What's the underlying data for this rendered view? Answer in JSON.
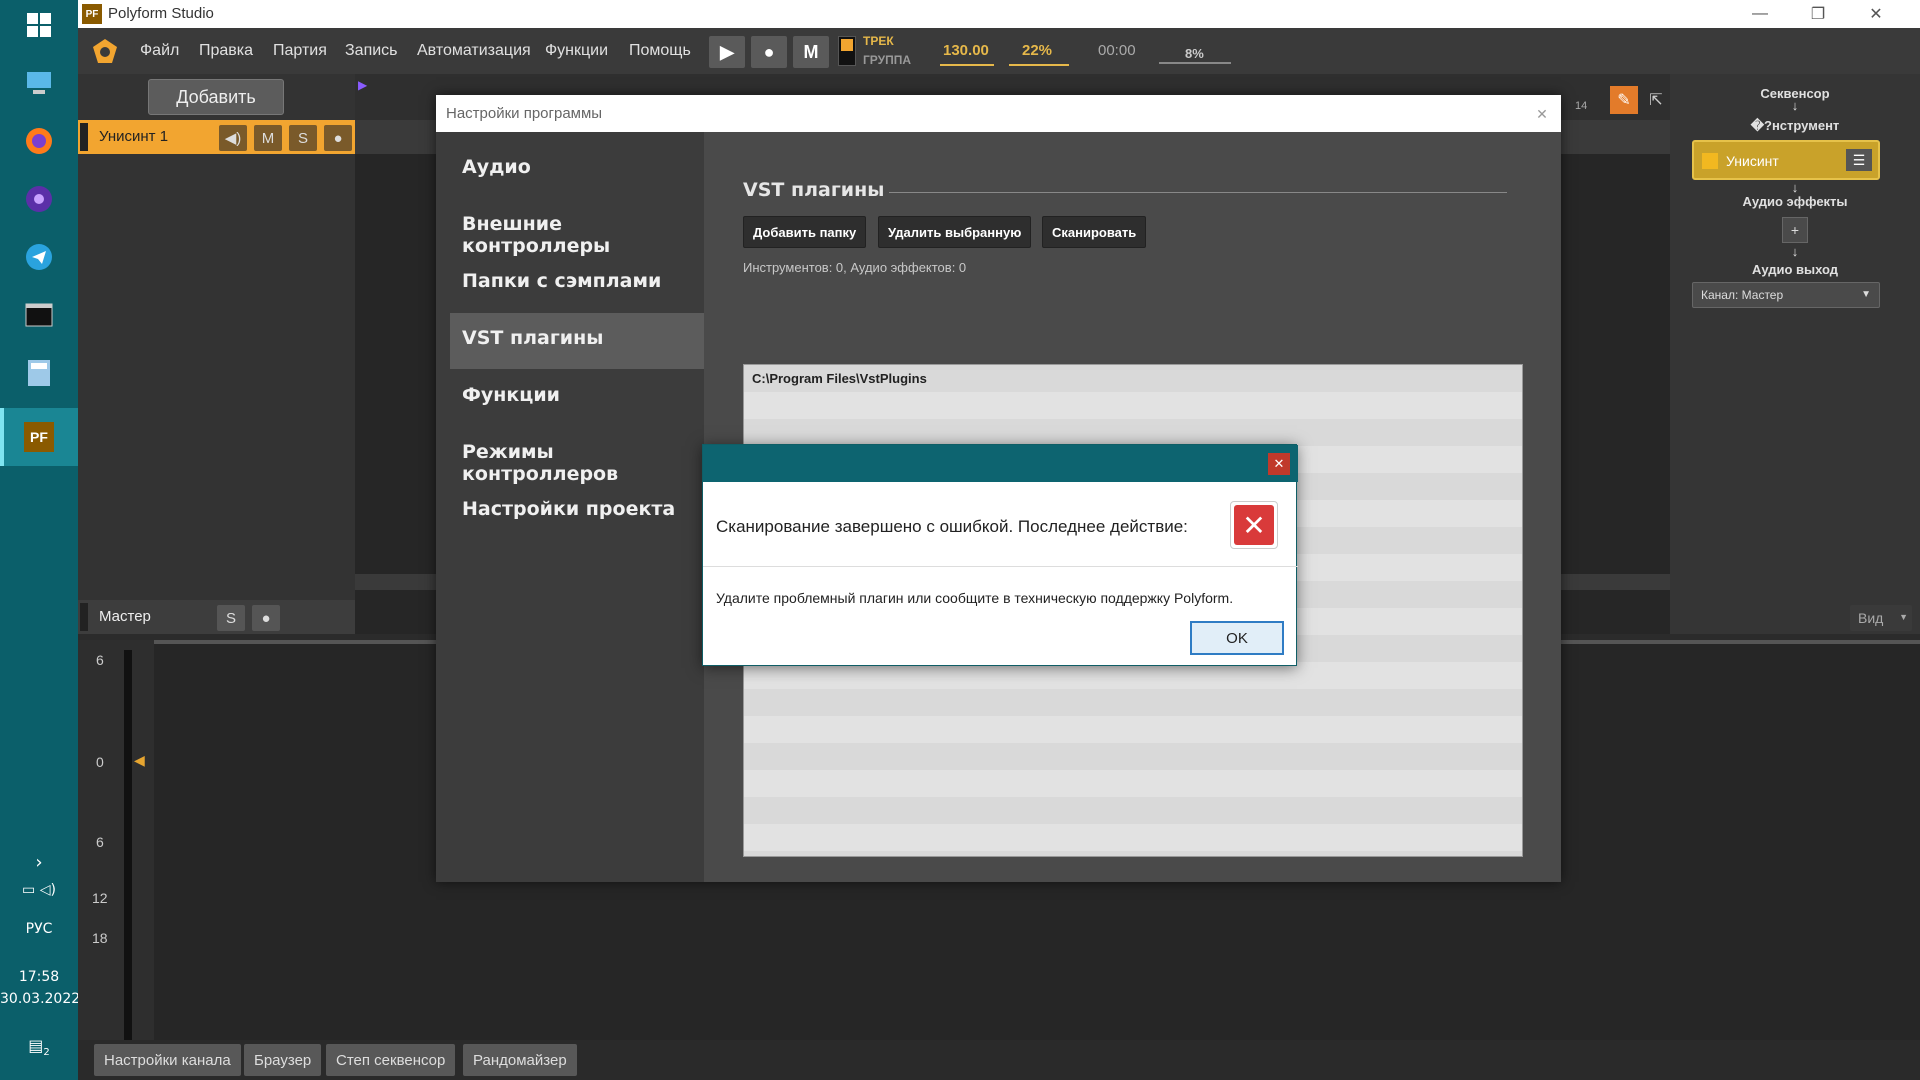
{
  "window": {
    "title": "Polyform Studio",
    "app_icon": "PF"
  },
  "menu": [
    "Файл",
    "Правка",
    "Партия",
    "Запись",
    "Автоматизация",
    "Функции",
    "Помощь"
  ],
  "transport": {
    "m_label": "M",
    "track_label": "ТРЕК",
    "group_label": "ГРУППА",
    "tempo": "130.00",
    "percent": "22%",
    "time": "00:00",
    "cpu": "8%"
  },
  "left_panel": {
    "add_label": "Добавить",
    "track_name": "Унисинт 1",
    "m_label": "M",
    "s_label": "S",
    "master_label": "Мастер",
    "master_s": "S"
  },
  "arrange": {
    "ruler_mark": "14"
  },
  "right_panel": {
    "sequencer": "Секвенсор",
    "instrument": "�?нструмент",
    "instrument_name": "Унисинт",
    "audio_effects": "Аудио эффекты",
    "add_effect": "+",
    "audio_out": "Аудио выход",
    "channel": "Канал: Мастер",
    "view": "Вид"
  },
  "mixer": {
    "scale": [
      "6",
      "0",
      "6",
      "12",
      "18"
    ]
  },
  "bottom_tabs": [
    "Настройки канала",
    "Браузер",
    "Степ секвенсор",
    "Рандомайзер"
  ],
  "settings": {
    "title": "Настройки программы",
    "nav": [
      "Аудио",
      "Внешние контроллеры",
      "Папки с сэмплами",
      "VST плагины",
      "Функции",
      "Режимы контроллеров",
      "Настройки проекта"
    ],
    "active_nav": "VST плагины",
    "section_title": "VST плагины",
    "buttons": {
      "add_folder": "Добавить папку",
      "remove_selected": "Удалить выбранную",
      "scan": "Сканировать"
    },
    "counts": "Инструментов: 0, Аудио эффектов: 0",
    "paths": [
      "C:\\Program Files\\VstPlugins"
    ]
  },
  "error_dialog": {
    "message": "Сканирование завершено с ошибкой. Последнее действие:",
    "hint": "Удалите проблемный плагин или сообщите в техническую поддержку Polyform.",
    "ok": "OK"
  },
  "taskbar": {
    "lang": "РУС",
    "time": "17:58",
    "date": "30.03.2022",
    "notif_count": "2"
  },
  "colors": {
    "accent": "#f2a530",
    "dialog_title": "#0d6470",
    "taskbar": "#0b5f6a"
  }
}
